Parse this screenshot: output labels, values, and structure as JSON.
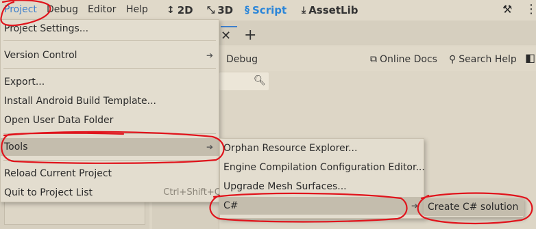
{
  "menubar": {
    "menus": [
      "Project",
      "Debug",
      "Editor",
      "Help"
    ],
    "workspaces": [
      {
        "label": "2D",
        "icon": "move-2d-icon"
      },
      {
        "label": "3D",
        "icon": "move-3d-icon"
      },
      {
        "label": "Script",
        "icon": "script-icon"
      },
      {
        "label": "AssetLib",
        "icon": "download-icon"
      }
    ],
    "active_workspace": "Script"
  },
  "script_editor": {
    "toolbar": {
      "debug_label": "Debug",
      "online_docs_label": "Online Docs",
      "search_help_label": "Search Help"
    }
  },
  "project_menu": {
    "items": [
      "Project Settings...",
      "Version Control",
      "Export...",
      "Install Android Build Template...",
      "Open User Data Folder",
      "Tools",
      "Reload Current Project",
      "Quit to Project List"
    ],
    "quit_shortcut": "Ctrl+Shift+Q"
  },
  "tools_menu": {
    "items": [
      "Orphan Resource Explorer...",
      "Engine Compilation Configuration Editor...",
      "Upgrade Mesh Surfaces...",
      "C#"
    ]
  },
  "csharp_menu": {
    "items": [
      "Create C# solution"
    ]
  },
  "colors": {
    "accent": "#3d7fcc",
    "annotation": "#e0141c",
    "menu_bg": "#e3ddcf",
    "highlight_bg": "#c4bdad"
  }
}
